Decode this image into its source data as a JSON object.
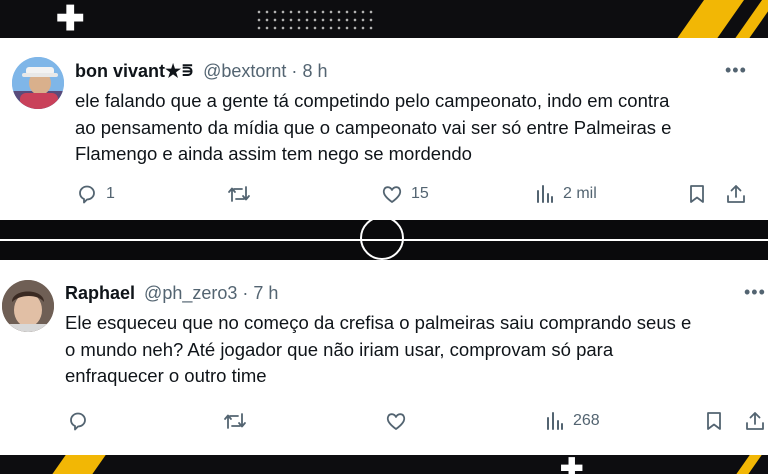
{
  "colors": {
    "accent_stripe": "#f2b705",
    "background": "#0b0b0d",
    "card": "#ffffff",
    "text_primary": "#0f1419",
    "text_secondary": "#536471"
  },
  "tweets": [
    {
      "author_name": "bon vivant",
      "name_badge": "★⋾",
      "handle": "@bextornt",
      "separator": "·",
      "time": "8 h",
      "text": "ele falando que a gente tá competindo pelo campeonato, indo em contra\nao pensamento da mídia que o campeonato vai ser só entre Palmeiras e\nFlamengo e ainda assim tem nego se mordendo",
      "more_label": "•••",
      "replies": "1",
      "retweets": "",
      "likes": "15",
      "views": "2 mil",
      "icons": [
        "reply-icon",
        "retweet-icon",
        "like-icon",
        "views-icon",
        "bookmark-icon",
        "share-icon"
      ]
    },
    {
      "author_name": "Raphael",
      "handle": "@ph_zero3",
      "separator": "·",
      "time": "7 h",
      "text": "Ele esqueceu que no começo da crefisa o palmeiras saiu comprando seus e\no mundo neh? Até jogador que não iriam usar, comprovam só para\nenfraquecer o outro time",
      "more_label": "•••",
      "replies": "",
      "retweets": "",
      "likes": "",
      "views": "268",
      "icons": [
        "reply-icon",
        "retweet-icon",
        "like-icon",
        "views-icon",
        "bookmark-icon",
        "share-icon"
      ]
    }
  ]
}
